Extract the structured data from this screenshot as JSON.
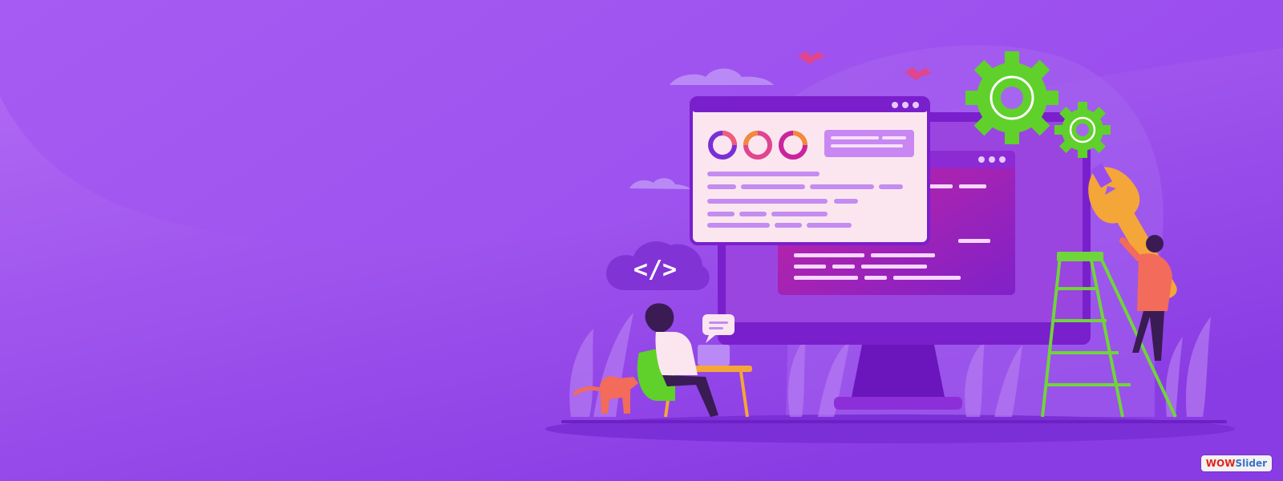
{
  "hero": {
    "cloud_code_tag": "</>",
    "colors": {
      "background": "#8e3fe6",
      "background_light": "#b06cf5",
      "gear": "#5fd12a",
      "wrench": "#f4a638",
      "card": "#fbe6f0",
      "code_panel": "#c0219b",
      "monitor": "#7a1fcc"
    },
    "icons": [
      "code-cloud-icon",
      "gear-icon",
      "wrench-icon",
      "bird-icon",
      "laptop-icon",
      "chat-bubble-icon"
    ]
  },
  "watermark": {
    "part1": "WOW",
    "part2": "Slider"
  }
}
